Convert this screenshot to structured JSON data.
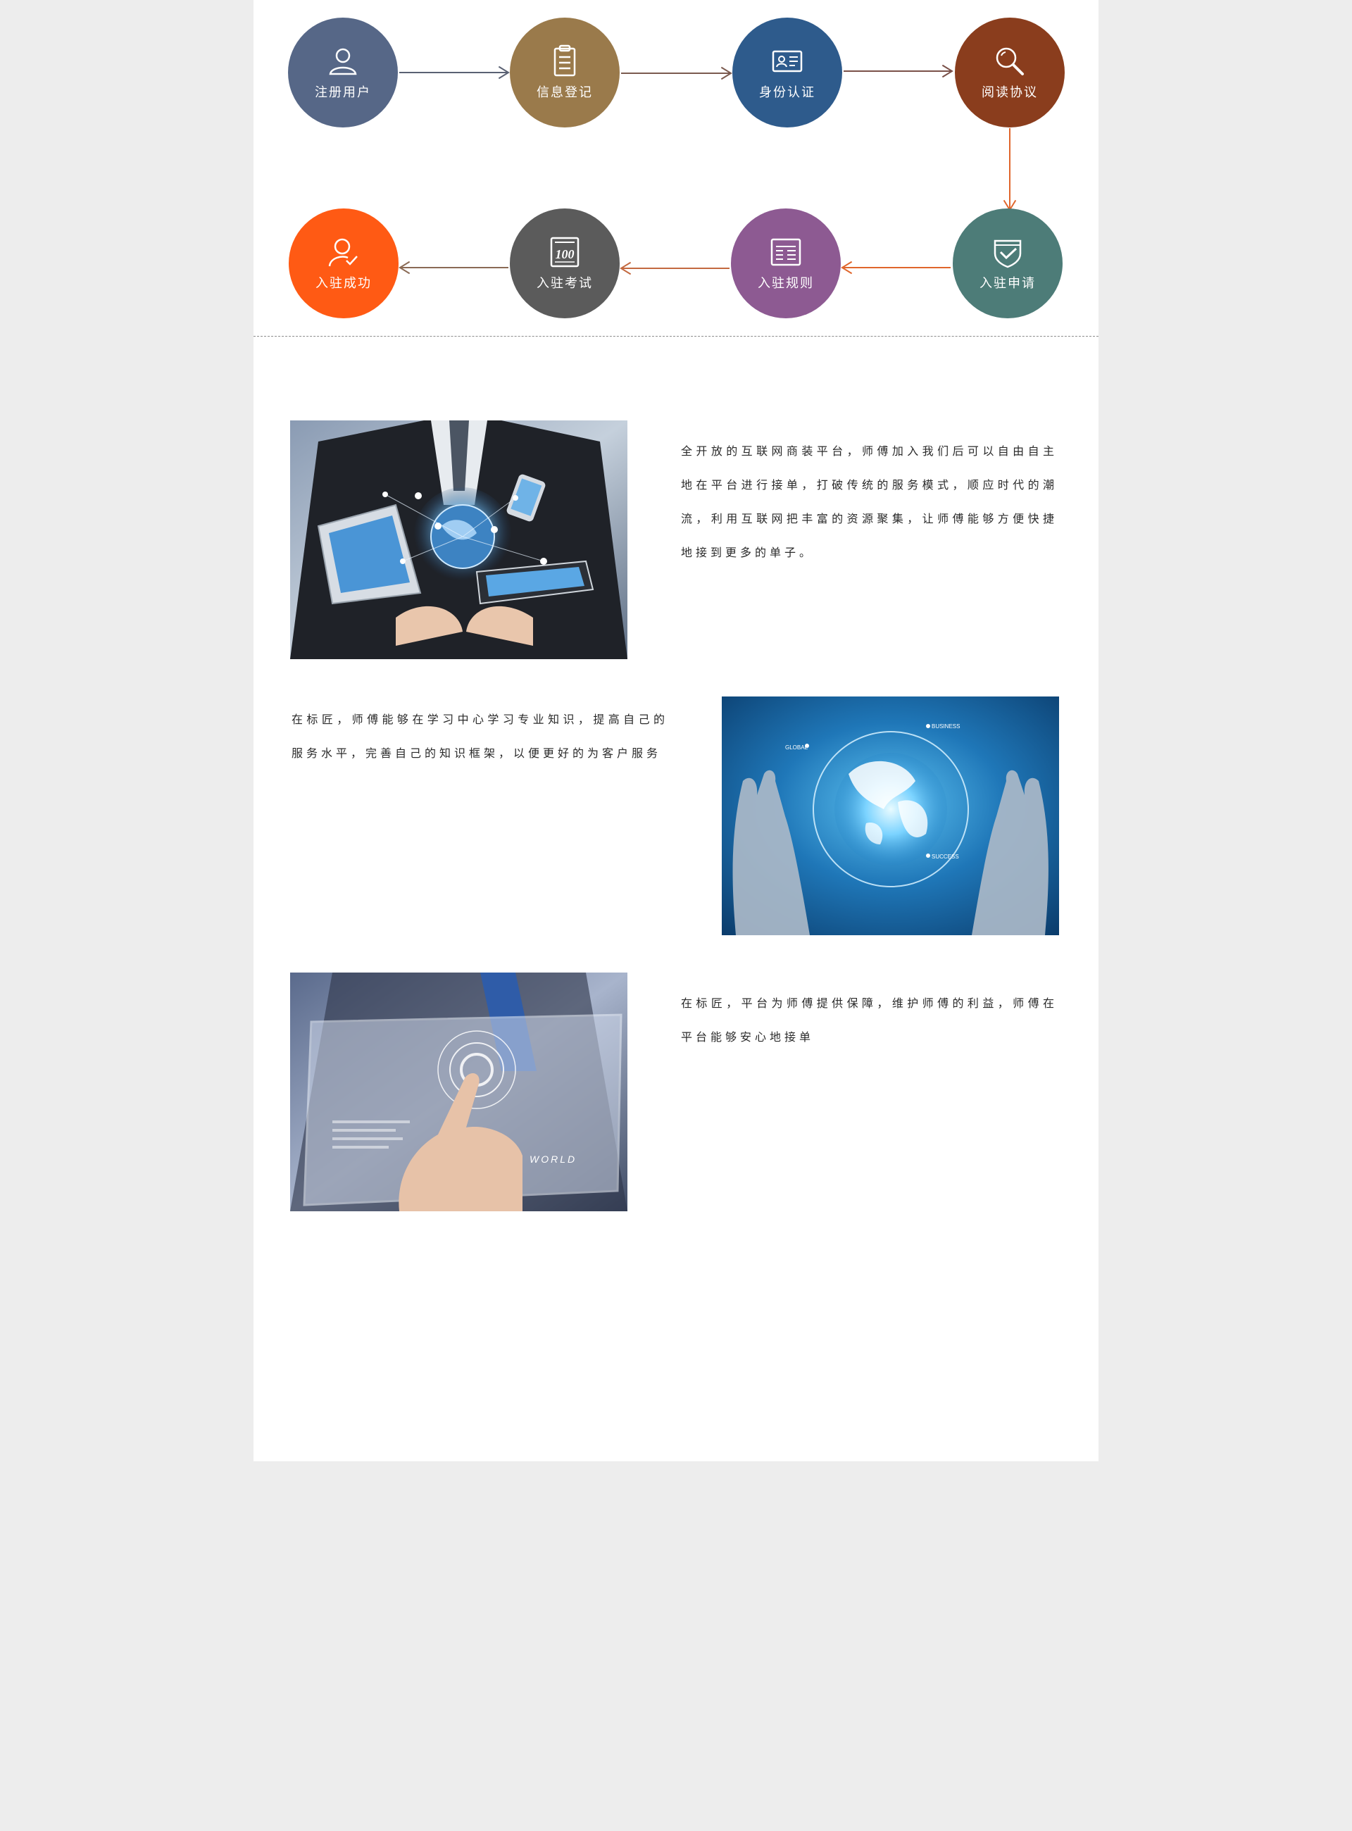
{
  "flow": {
    "steps": [
      {
        "label": "注册用户",
        "icon": "user-icon",
        "color": "#566787"
      },
      {
        "label": "信息登记",
        "icon": "clipboard-icon",
        "color": "#9a7a4b"
      },
      {
        "label": "身份认证",
        "icon": "id-card-icon",
        "color": "#2e5b8c"
      },
      {
        "label": "阅读协议",
        "icon": "magnifier-icon",
        "color": "#8a3d1d"
      },
      {
        "label": "入驻申请",
        "icon": "shield-check-icon",
        "color": "#4d7c78"
      },
      {
        "label": "入驻规则",
        "icon": "rules-list-icon",
        "color": "#8d5a92"
      },
      {
        "label": "入驻考试",
        "icon": "exam-100-icon",
        "color": "#5b5b5b"
      },
      {
        "label": "入驻成功",
        "icon": "user-check-icon",
        "color": "#ff5a14"
      }
    ],
    "arrow_colors": {
      "step1_to_2": "#5a6173",
      "step2_to_3": "#7b5a4f",
      "step3_to_4": "#7a5048",
      "step4_to_5": "#e0662c",
      "step5_to_6": "#e0662c",
      "step6_to_7": "#c36940",
      "step7_to_8": "#8a6a55"
    }
  },
  "sections": [
    {
      "image": "business-hands-devices-network-image",
      "text": "全开放的互联网商装平台，师傅加入我们后可以自由自主地在平台进行接单，打破传统的服务模式，顺应时代的潮流，利用互联网把丰富的资源聚集，让师傅能够方便快捷地接到更多的单子。"
    },
    {
      "image": "hands-glowing-globe-image",
      "globe_labels": [
        "GLOBAL",
        "BUSINESS",
        "SUCCESS"
      ],
      "text": "在标匠，师傅能够在学习中心学习专业知识，提高自己的服务水平，完善自己的知识框架，以便更好的为客户服务"
    },
    {
      "image": "finger-touch-screen-image",
      "screen_labels": [
        "WORLD"
      ],
      "text": "在标匠，平台为师傅提供保障，维护师傅的利益，师傅在平台能够安心地接单"
    }
  ]
}
